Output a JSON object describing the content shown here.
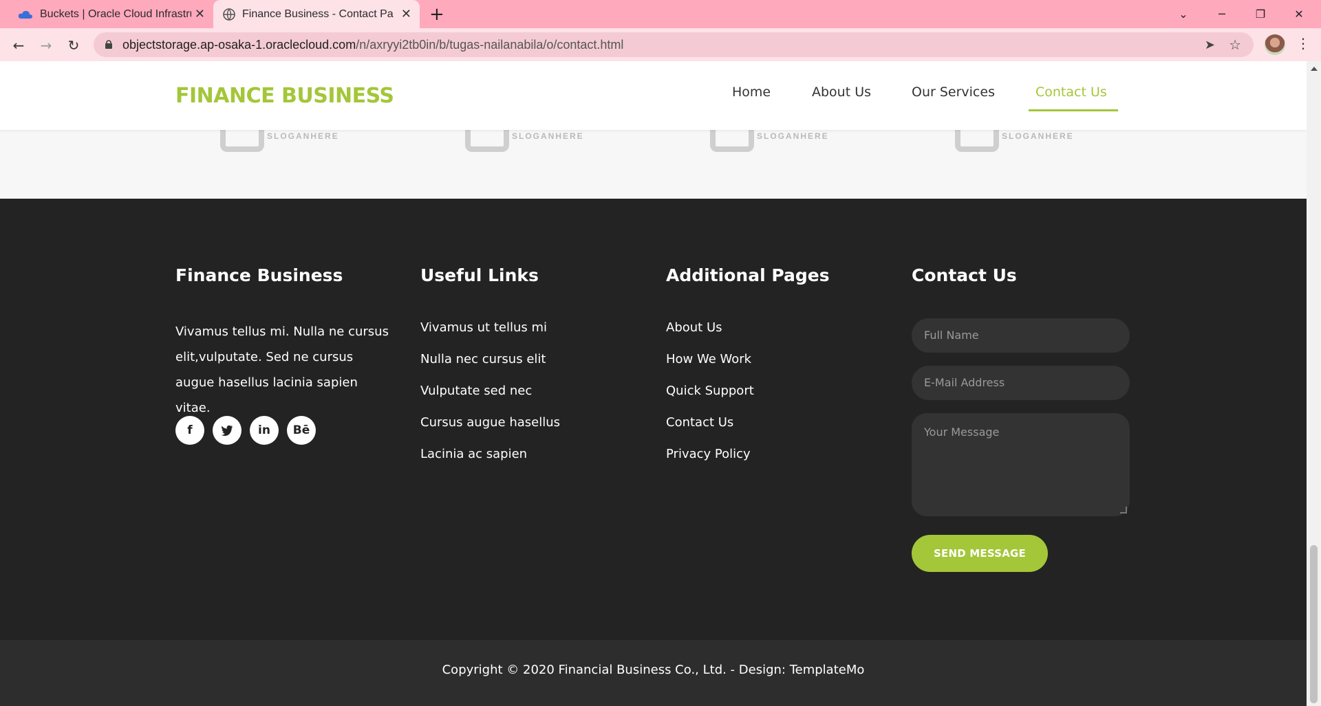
{
  "browser": {
    "tabs": [
      {
        "title": "Buckets | Oracle Cloud Infrastruct",
        "icon": "cloud-icon",
        "active": false
      },
      {
        "title": "Finance Business - Contact Page",
        "icon": "globe-icon",
        "active": true
      }
    ],
    "url_host": "objectstorage.ap-osaka-1.oraclecloud.com",
    "url_path": "/n/axryyi2tb0in/b/tugas-nailanabila/o/contact.html"
  },
  "colors": {
    "accent": "#a4c639",
    "footer_bg": "#232323",
    "tab_bar": "#ffa9bd"
  },
  "header": {
    "brand": "FINANCE BUSINESS",
    "nav": [
      {
        "label": "Home",
        "active": false
      },
      {
        "label": "About Us",
        "active": false
      },
      {
        "label": "Our Services",
        "active": false
      },
      {
        "label": "Contact Us",
        "active": true
      }
    ]
  },
  "partners": {
    "slogans": [
      "SLOGANHERE",
      "SLOGANHERE",
      "SLOGANHERE",
      "SLOGANHERE"
    ]
  },
  "footer": {
    "about": {
      "title": "Finance Business",
      "text": "Vivamus tellus mi. Nulla ne cursus elit,vulputate. Sed ne cursus augue hasellus lacinia sapien vitae.",
      "social": [
        {
          "glyph": "f",
          "icon": "facebook-icon"
        },
        {
          "glyph": "t",
          "icon": "twitter-icon"
        },
        {
          "glyph": "in",
          "icon": "linkedin-icon"
        },
        {
          "glyph": "Bē",
          "icon": "behance-icon"
        }
      ]
    },
    "useful_links": {
      "title": "Useful Links",
      "items": [
        "Vivamus ut tellus mi",
        "Nulla nec cursus elit",
        "Vulputate sed nec",
        "Cursus augue hasellus",
        "Lacinia ac sapien"
      ]
    },
    "additional_pages": {
      "title": "Additional Pages",
      "items": [
        "About Us",
        "How We Work",
        "Quick Support",
        "Contact Us",
        "Privacy Policy"
      ]
    },
    "contact": {
      "title": "Contact Us",
      "name_placeholder": "Full Name",
      "email_placeholder": "E-Mail Address",
      "message_placeholder": "Your Message",
      "submit": "SEND MESSAGE"
    },
    "copyright": "Copyright © 2020 Financial Business Co., Ltd. - Design: TemplateMo"
  }
}
